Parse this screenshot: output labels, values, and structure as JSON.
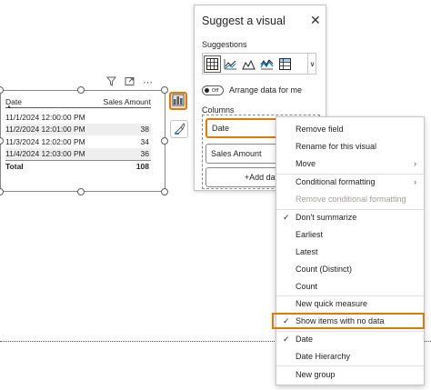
{
  "table": {
    "col_date": "Date",
    "col_sales": "Sales Amount",
    "rows": [
      {
        "date": "11/1/2024 12:00:00 PM",
        "amount": ""
      },
      {
        "date": "11/2/2024 12:01:00 PM",
        "amount": "38"
      },
      {
        "date": "11/3/2024 12:02:00 PM",
        "amount": "34"
      },
      {
        "date": "11/4/2024 12:03:00 PM",
        "amount": "36"
      }
    ],
    "total_label": "Total",
    "total_value": "108"
  },
  "visual_toolbar": {
    "filter_icon": "filter-icon",
    "focus_icon": "focus-mode-icon",
    "more_icon": "more-options-icon",
    "more_glyph": "⋯"
  },
  "panel": {
    "title": "Suggest a visual",
    "close_glyph": "✕",
    "suggestions_label": "Suggestions",
    "chevron_glyph": "∨",
    "toggle_text": "Off",
    "arrange_label": "Arrange data for me",
    "columns_label": "Columns",
    "field_date": "Date",
    "field_sales": "Sales Amount",
    "add_data": "+Add dat"
  },
  "menu": {
    "remove_field": "Remove field",
    "rename": "Rename for this visual",
    "move": "Move",
    "cond_format": "Conditional formatting",
    "remove_cond": "Remove conditional formatting",
    "dont_summarize": "Don't summarize",
    "earliest": "Earliest",
    "latest": "Latest",
    "count_distinct": "Count (Distinct)",
    "count": "Count",
    "new_quick_measure": "New quick measure",
    "show_items": "Show items with no data",
    "date": "Date",
    "date_hierarchy": "Date Hierarchy",
    "new_group": "New group",
    "check_glyph": "✓",
    "arrow_glyph": "›"
  },
  "colors": {
    "highlight_orange": "#e07a00",
    "border_gray": "#8a8886",
    "row_shade": "#eeeeee"
  }
}
